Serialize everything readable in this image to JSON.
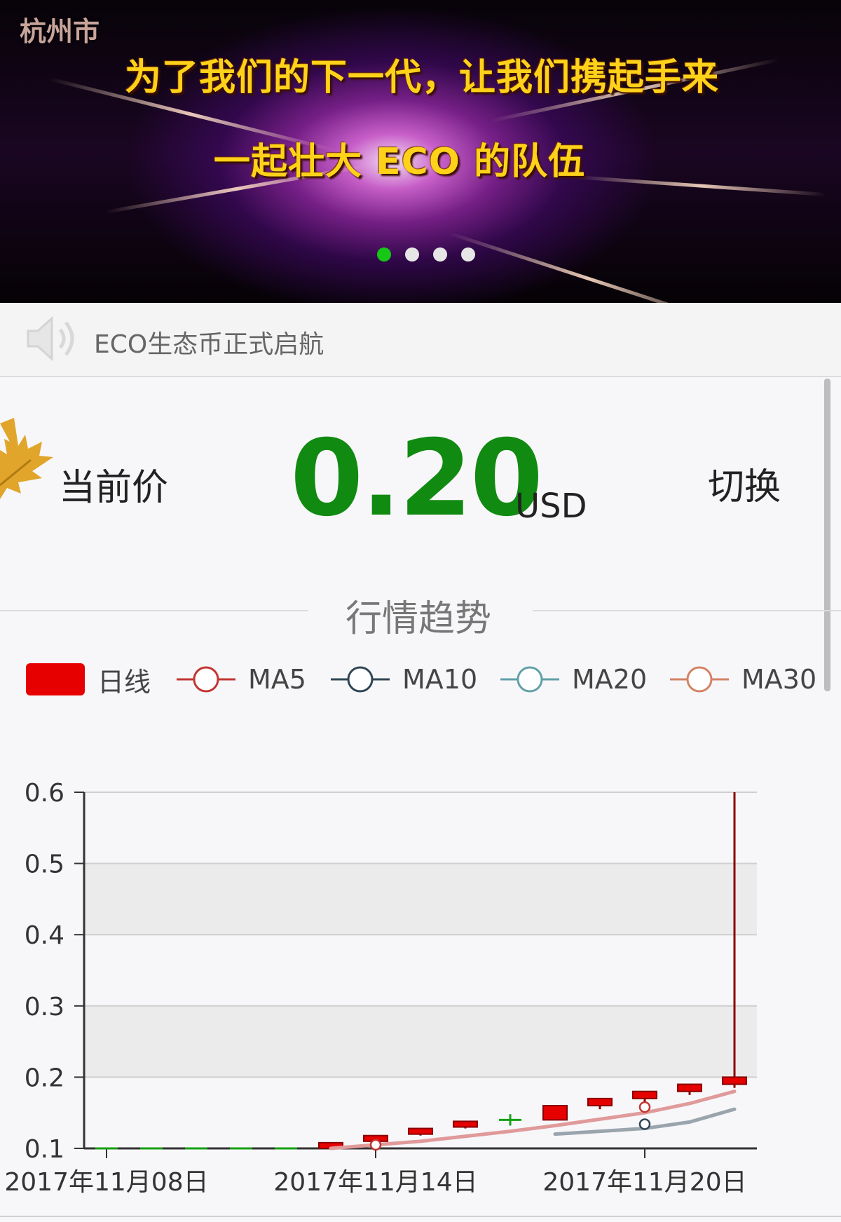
{
  "banner": {
    "city": "杭州市",
    "line1": "为了我们的下一代，让我们携起手来",
    "line2": "一起壮大 ECO 的队伍",
    "indicator": {
      "count": 4,
      "active_index": 0
    },
    "colors": {
      "indicator_active": "#16c716",
      "indicator_inactive": "#e6e6e6",
      "headline": "#ffd21a"
    }
  },
  "notice": {
    "icon": "speaker-icon",
    "text": "ECO生态币正式启航"
  },
  "price": {
    "icon": "maple-leaf-icon",
    "label": "当前价",
    "value": "0.20",
    "unit": "USD",
    "switch_label": "切换",
    "color": "#118a11"
  },
  "section": {
    "title": "行情趋势"
  },
  "legend": [
    {
      "label": "日线",
      "color": "#e60000",
      "icon": "candle-swatch-icon"
    },
    {
      "label": "MA5",
      "color": "#c23531",
      "icon": "circle-line-icon"
    },
    {
      "label": "MA10",
      "color": "#2f4554",
      "icon": "circle-line-icon"
    },
    {
      "label": "MA20",
      "color": "#61a0a8",
      "icon": "circle-line-icon"
    },
    {
      "label": "MA30",
      "color": "#d48265",
      "icon": "circle-line-icon"
    }
  ],
  "chart_data": {
    "type": "candlestick",
    "ylim": [
      0.1,
      0.6
    ],
    "y_ticks": [
      "0.1",
      "0.2",
      "0.3",
      "0.4",
      "0.5",
      "0.6"
    ],
    "x_tick_labels": [
      {
        "label": "2017年11月08日",
        "index": 0
      },
      {
        "label": "2017年11月14日",
        "index": 6
      },
      {
        "label": "2017年11月20日",
        "index": 12
      }
    ],
    "grid": true,
    "legend_placement": "top",
    "candles": [
      {
        "index": 0,
        "open": 0.1,
        "close": 0.1,
        "low": 0.1,
        "high": 0.1
      },
      {
        "index": 1,
        "open": 0.1,
        "close": 0.1,
        "low": 0.1,
        "high": 0.1
      },
      {
        "index": 2,
        "open": 0.1,
        "close": 0.1,
        "low": 0.1,
        "high": 0.1
      },
      {
        "index": 3,
        "open": 0.1,
        "close": 0.1,
        "low": 0.1,
        "high": 0.1
      },
      {
        "index": 4,
        "open": 0.1,
        "close": 0.1,
        "low": 0.1,
        "high": 0.1
      },
      {
        "index": 5,
        "open": 0.1,
        "close": 0.108,
        "low": 0.1,
        "high": 0.108
      },
      {
        "index": 6,
        "open": 0.11,
        "close": 0.118,
        "low": 0.1,
        "high": 0.118
      },
      {
        "index": 7,
        "open": 0.12,
        "close": 0.128,
        "low": 0.118,
        "high": 0.128
      },
      {
        "index": 8,
        "open": 0.13,
        "close": 0.138,
        "low": 0.128,
        "high": 0.138
      },
      {
        "index": 9,
        "open": 0.14,
        "close": 0.14,
        "low": 0.132,
        "high": 0.148
      },
      {
        "index": 10,
        "open": 0.14,
        "close": 0.16,
        "low": 0.14,
        "high": 0.16
      },
      {
        "index": 11,
        "open": 0.16,
        "close": 0.17,
        "low": 0.155,
        "high": 0.17
      },
      {
        "index": 12,
        "open": 0.17,
        "close": 0.18,
        "low": 0.165,
        "high": 0.18
      },
      {
        "index": 13,
        "open": 0.18,
        "close": 0.19,
        "low": 0.175,
        "high": 0.19
      },
      {
        "index": 14,
        "open": 0.19,
        "close": 0.2,
        "low": 0.185,
        "high": 0.6
      }
    ],
    "series": [
      {
        "name": "MA5",
        "color": "#e09a9a",
        "x": [
          5,
          6,
          7,
          8,
          9,
          10,
          11,
          12,
          13,
          14
        ],
        "values": [
          0.1,
          0.105,
          0.11,
          0.117,
          0.124,
          0.132,
          0.141,
          0.15,
          0.163,
          0.18
        ]
      },
      {
        "name": "MA10",
        "color": "#9aa4ad",
        "x": [
          10,
          11,
          12,
          13,
          14
        ],
        "values": [
          0.12,
          0.124,
          0.128,
          0.137,
          0.155
        ]
      }
    ],
    "markers": [
      {
        "series": "MA5",
        "index": 6,
        "value": 0.105
      },
      {
        "series": "MA5",
        "index": 12,
        "value": 0.158
      },
      {
        "series": "MA10",
        "index": 12,
        "value": 0.134
      }
    ]
  }
}
